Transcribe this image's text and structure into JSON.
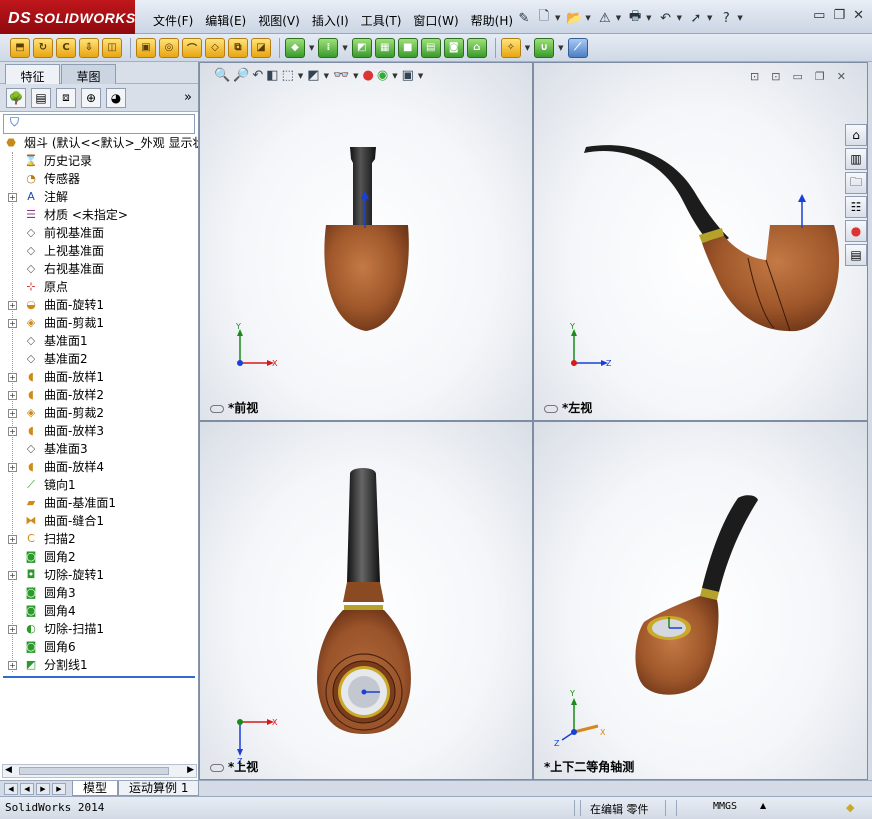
{
  "app": {
    "logo": "SOLIDWORKS",
    "logo_mark": "DS"
  },
  "menu": {
    "items": [
      "文件(F)",
      "编辑(E)",
      "视图(V)",
      "插入(I)",
      "工具(T)",
      "窗口(W)",
      "帮助(H)"
    ]
  },
  "left_panel": {
    "tabs": [
      "特征",
      "草图"
    ],
    "filter_icon": "funnel-icon",
    "tree": {
      "root": "烟斗  (默认<<默认>_外观 显示状",
      "items": [
        {
          "label": "历史记录",
          "icon": "history-icon",
          "expandable": false
        },
        {
          "label": "传感器",
          "icon": "sensor-icon",
          "expandable": false
        },
        {
          "label": "注解",
          "icon": "annotation-icon",
          "expandable": true
        },
        {
          "label": "材质 <未指定>",
          "icon": "material-icon",
          "expandable": false
        },
        {
          "label": "前视基准面",
          "icon": "plane-icon",
          "expandable": false
        },
        {
          "label": "上视基准面",
          "icon": "plane-icon",
          "expandable": false
        },
        {
          "label": "右视基准面",
          "icon": "plane-icon",
          "expandable": false
        },
        {
          "label": "原点",
          "icon": "origin-icon",
          "expandable": false
        },
        {
          "label": "曲面-旋转1",
          "icon": "surface-revolve-icon",
          "expandable": true
        },
        {
          "label": "曲面-剪裁1",
          "icon": "surface-trim-icon",
          "expandable": true
        },
        {
          "label": "基准面1",
          "icon": "plane-icon",
          "expandable": false
        },
        {
          "label": "基准面2",
          "icon": "plane-icon",
          "expandable": false
        },
        {
          "label": "曲面-放样1",
          "icon": "surface-loft-icon",
          "expandable": true
        },
        {
          "label": "曲面-放样2",
          "icon": "surface-loft-icon",
          "expandable": true
        },
        {
          "label": "曲面-剪裁2",
          "icon": "surface-trim-icon",
          "expandable": true
        },
        {
          "label": "曲面-放样3",
          "icon": "surface-loft-icon",
          "expandable": true
        },
        {
          "label": "基准面3",
          "icon": "plane-icon",
          "expandable": false
        },
        {
          "label": "曲面-放样4",
          "icon": "surface-loft-icon",
          "expandable": true
        },
        {
          "label": "镜向1",
          "icon": "mirror-icon",
          "expandable": false
        },
        {
          "label": "曲面-基准面1",
          "icon": "planar-surface-icon",
          "expandable": false
        },
        {
          "label": "曲面-缝合1",
          "icon": "knit-icon",
          "expandable": false
        },
        {
          "label": "扫描2",
          "icon": "sweep-icon",
          "expandable": true
        },
        {
          "label": "圆角2",
          "icon": "fillet-icon",
          "expandable": false
        },
        {
          "label": "切除-旋转1",
          "icon": "cut-revolve-icon",
          "expandable": true
        },
        {
          "label": "圆角3",
          "icon": "fillet-icon",
          "expandable": false
        },
        {
          "label": "圆角4",
          "icon": "fillet-icon",
          "expandable": false
        },
        {
          "label": "切除-扫描1",
          "icon": "cut-sweep-icon",
          "expandable": true
        },
        {
          "label": "圆角6",
          "icon": "fillet-icon",
          "expandable": false
        },
        {
          "label": "分割线1",
          "icon": "split-line-icon",
          "expandable": true
        }
      ]
    }
  },
  "viewports": [
    {
      "label": "*前视",
      "axes": [
        "Y",
        "X"
      ]
    },
    {
      "label": "*左视",
      "axes": [
        "Y",
        "Z"
      ]
    },
    {
      "label": "*上视",
      "axes": [
        "X",
        "Z"
      ]
    },
    {
      "label": "*上下二等角轴测",
      "axes": [
        "Y",
        "Z",
        "X"
      ]
    }
  ],
  "bottom_tabs": [
    "模型",
    "运动算例 1"
  ],
  "status": {
    "app_version": "SolidWorks 2014",
    "mode": "在编辑 零件",
    "units": "MMGS"
  },
  "colors": {
    "bowl": "#a0582b",
    "stem": "#1f1f1f",
    "band": "#b5a22a",
    "brand": "#b3141a"
  }
}
